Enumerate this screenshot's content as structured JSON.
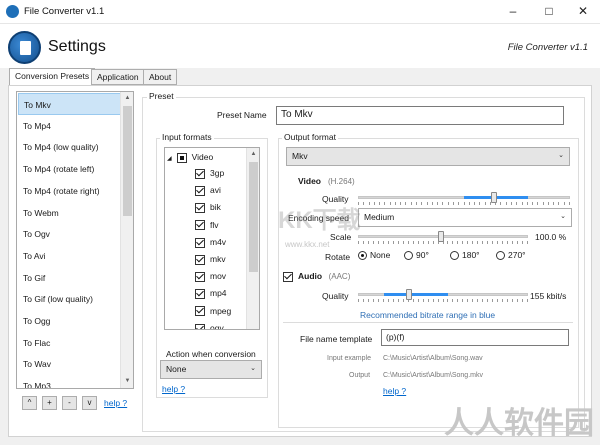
{
  "window": {
    "title": "File Converter v1.1"
  },
  "header": {
    "title": "Settings",
    "app_name": "File Converter v1.1"
  },
  "tabs": [
    {
      "label": "Conversion Presets",
      "active": true
    },
    {
      "label": "Application",
      "active": false
    },
    {
      "label": "About",
      "active": false
    }
  ],
  "presets": {
    "items": [
      "To Mkv",
      "To Mp4",
      "To Mp4 (low quality)",
      "To Mp4 (rotate left)",
      "To Mp4 (rotate right)",
      "To Webm",
      "To Ogv",
      "To Avi",
      "To Gif",
      "To Gif (low quality)",
      "To Ogg",
      "To Flac",
      "To Wav",
      "To Mp3"
    ],
    "selected": "To Mkv",
    "buttons": [
      "^",
      "+",
      "-",
      "v"
    ],
    "help_label": "help ?"
  },
  "preset_group": {
    "label": "Preset",
    "name_label": "Preset Name",
    "name_value": "To Mkv"
  },
  "input_formats": {
    "label": "Input formats",
    "root": "Video",
    "items": [
      {
        "name": "3gp",
        "checked": true
      },
      {
        "name": "avi",
        "checked": true
      },
      {
        "name": "bik",
        "checked": true
      },
      {
        "name": "flv",
        "checked": true
      },
      {
        "name": "m4v",
        "checked": true
      },
      {
        "name": "mkv",
        "checked": true
      },
      {
        "name": "mov",
        "checked": true
      },
      {
        "name": "mp4",
        "checked": true
      },
      {
        "name": "mpeg",
        "checked": true
      },
      {
        "name": "ogv",
        "checked": true
      }
    ],
    "action_label": "Action when conversion",
    "action_value": "None",
    "help_label": "help ?"
  },
  "output": {
    "label": "Output format",
    "format": "Mkv",
    "video_label": "Video",
    "video_codec": "(H.264)",
    "quality_label": "Quality",
    "video_quality": 0.64,
    "encoding_speed_label": "Encoding speed",
    "encoding_speed_value": "Medium",
    "scale_label": "Scale",
    "scale_value": "100.0 %",
    "scale_level": 0.49,
    "rotate_label": "Rotate",
    "rotate_options": [
      "None",
      "90°",
      "180°",
      "270°"
    ],
    "rotate_selected": "None",
    "audio_label": "Audio",
    "audio_codec": "(AAC)",
    "audio_quality_label": "Quality",
    "audio_quality_value": "155 kbit/s",
    "audio_level": 0.3,
    "audio_note": "Recommended bitrate range in blue",
    "file_name_template_label": "File name template",
    "file_name_template_value": "(p)(f)",
    "input_example_label": "Input example",
    "input_example_value": "C:\\Music\\Artist\\Album\\Song.wav",
    "output_label": "Output",
    "output_value": "C:\\Music\\Artist\\Album\\Song.mkv",
    "help_label": "help ?"
  },
  "watermarks": {
    "top": "KK下载",
    "top_url": "www.kkx.net",
    "bottom": "人人软件园"
  },
  "colors": {
    "accent": "#2f8ef0",
    "selection": "#cce4f7",
    "link": "#0066cc"
  }
}
